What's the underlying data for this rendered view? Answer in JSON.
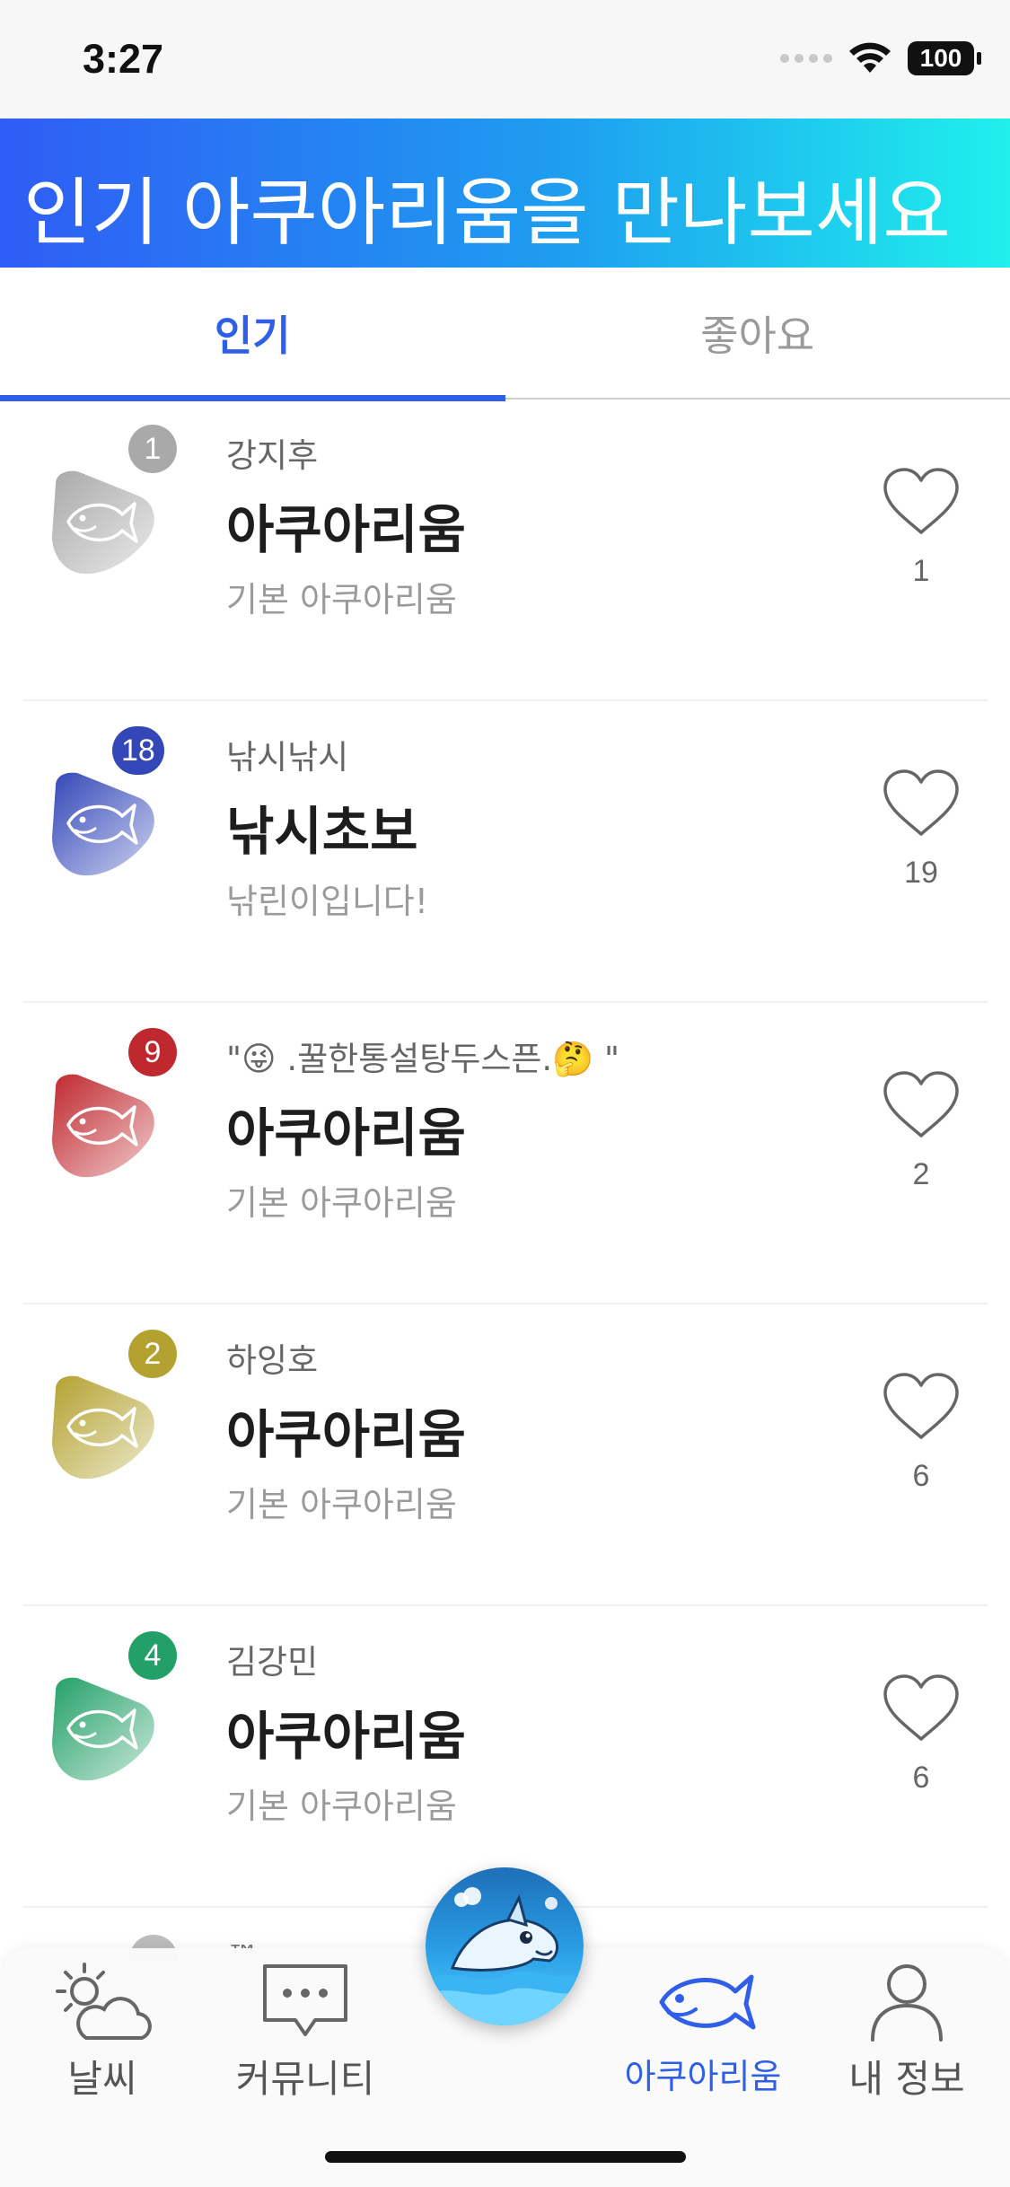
{
  "status_bar": {
    "time": "3:27",
    "battery": "100"
  },
  "banner": {
    "title": "인기 아쿠아리움을 만나보세요"
  },
  "tabs": [
    {
      "label": "인기",
      "active": true
    },
    {
      "label": "좋아요",
      "active": false
    }
  ],
  "rows": [
    {
      "rank": "1",
      "owner": "강지후",
      "name": "아쿠아리움",
      "desc": "기본 아쿠아리움",
      "likes": "1",
      "color": "#a9a9a9",
      "badge_color": "#a9a9a9"
    },
    {
      "rank": "18",
      "owner": "낚시낚시",
      "name": "낚시초보",
      "desc": "낚린이입니다!",
      "likes": "19",
      "color": "#3347b8",
      "badge_color": "#3347b8"
    },
    {
      "rank": "9",
      "owner": "\"😜 .꿀한통설탕두스픈.🤔 \"",
      "name": "아쿠아리움",
      "desc": "기본 아쿠아리움",
      "likes": "2",
      "color": "#c0282f",
      "badge_color": "#c0282f"
    },
    {
      "rank": "2",
      "owner": "하잉호",
      "name": "아쿠아리움",
      "desc": "기본 아쿠아리움",
      "likes": "6",
      "color": "#b3a230",
      "badge_color": "#b3a230"
    },
    {
      "rank": "4",
      "owner": "김강민",
      "name": "아쿠아리움",
      "desc": "기본 아쿠아리움",
      "likes": "6",
      "color": "#23a068",
      "badge_color": "#23a068"
    }
  ],
  "partial_row": {
    "text": "™"
  },
  "tabbar": {
    "items": [
      {
        "label": "날씨",
        "icon": "weather-icon"
      },
      {
        "label": "커뮤니티",
        "icon": "chat-icon"
      },
      {
        "label": "아쿠아리움",
        "icon": "fish-icon",
        "active": true
      },
      {
        "label": "내 정보",
        "icon": "person-icon"
      }
    ]
  },
  "colors": {
    "accent": "#2f5fe8",
    "banner_start": "#2f5cf5",
    "banner_end": "#1ff0ec"
  }
}
